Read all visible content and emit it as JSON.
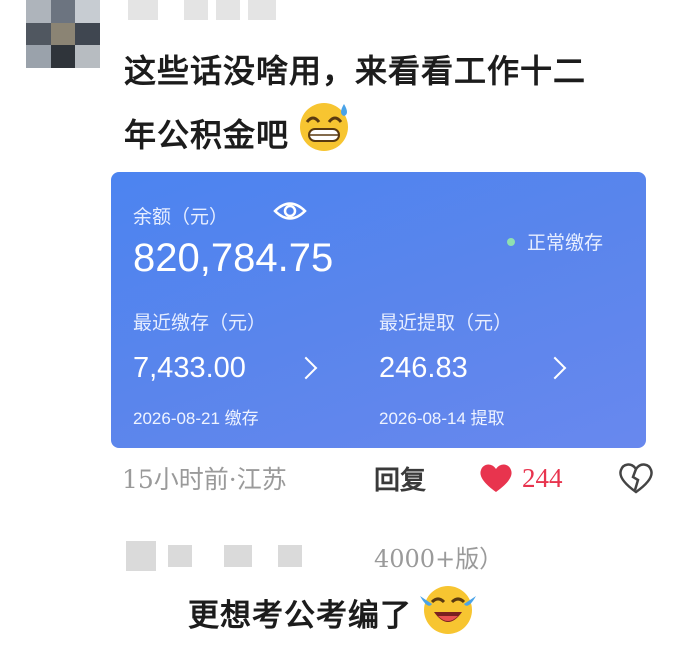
{
  "comment1": {
    "text_line1": "这些话没啥用，来看看工作十二",
    "text_line2": "年公积金吧",
    "emoji": "grinning-sweat-emoji"
  },
  "card": {
    "balance_label": "余额（元）",
    "balance": "820,784.75",
    "status": "正常缴存",
    "recent_deposit_label": "最近缴存（元）",
    "recent_deposit_amount": "7,433.00",
    "recent_deposit_date": "2026-08-21 缴存",
    "recent_withdraw_label": "最近提取（元）",
    "recent_withdraw_amount": "246.83",
    "recent_withdraw_date": "2026-08-14 提取",
    "colors": {
      "card_top": "#4c84f0",
      "card_bottom": "#6888ee",
      "status_dot": "#8fe0b0"
    }
  },
  "meta": {
    "time_location": "15小时前·江苏",
    "reply_label": "回复",
    "like_count": "244",
    "like_color": "#e8344e"
  },
  "comment2": {
    "version_fragment": "4000+版）",
    "text": "更想考公考编了",
    "emoji": "crying-laughing-emoji"
  }
}
